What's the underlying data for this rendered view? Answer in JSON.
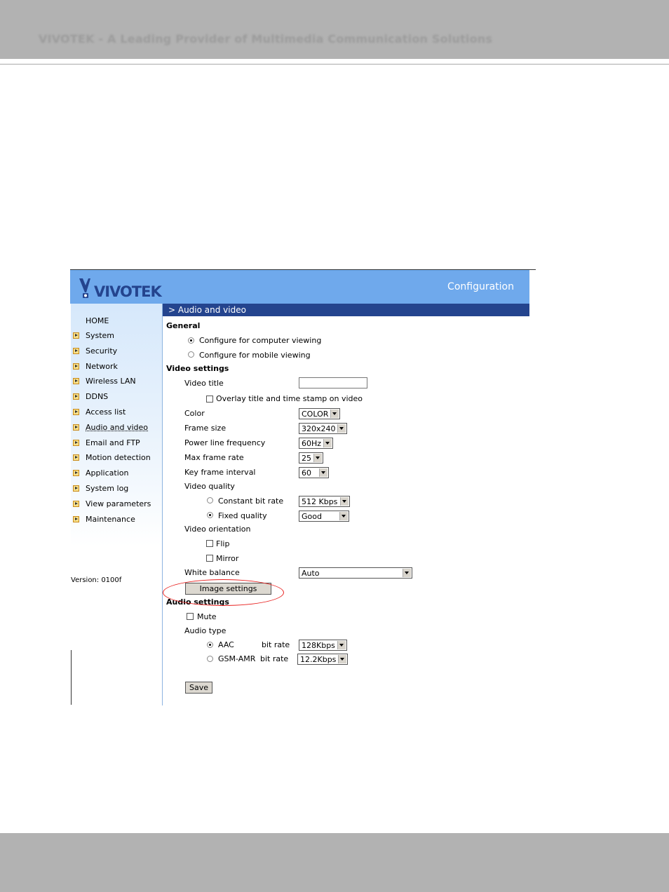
{
  "page_header": {
    "text": "VIVOTEK - A Leading Provider of Multimedia Communication Solutions"
  },
  "banner": {
    "logo_text": "VIVOTEK",
    "title": "Configuration"
  },
  "sidebar": {
    "home": "HOME",
    "items": [
      {
        "label": "System"
      },
      {
        "label": "Security"
      },
      {
        "label": "Network"
      },
      {
        "label": "Wireless LAN"
      },
      {
        "label": "DDNS"
      },
      {
        "label": "Access list"
      },
      {
        "label": "Audio and video"
      },
      {
        "label": "Email and FTP"
      },
      {
        "label": "Motion detection"
      },
      {
        "label": "Application"
      },
      {
        "label": "System log"
      },
      {
        "label": "View parameters"
      },
      {
        "label": "Maintenance"
      }
    ],
    "version": "Version: 0100f"
  },
  "section": {
    "title": "> Audio and video"
  },
  "general": {
    "heading": "General",
    "computer_viewing": "Configure for computer viewing",
    "mobile_viewing": "Configure for mobile viewing"
  },
  "video": {
    "heading": "Video settings",
    "title_label": "Video title",
    "title_value": "",
    "overlay_label": "Overlay title and time stamp on video",
    "color_label": "Color",
    "color_value": "COLOR",
    "frame_size_label": "Frame size",
    "frame_size_value": "320x240",
    "power_line_label": "Power line frequency",
    "power_line_value": "60Hz",
    "max_frame_rate_label": "Max frame rate",
    "max_frame_rate_value": "25",
    "key_frame_label": "Key frame interval",
    "key_frame_value": "60",
    "quality_label": "Video quality",
    "constant_bit_rate_label": "Constant bit rate",
    "constant_bit_rate_value": "512 Kbps",
    "fixed_quality_label": "Fixed quality",
    "fixed_quality_value": "Good",
    "orientation_label": "Video orientation",
    "flip_label": "Flip",
    "mirror_label": "Mirror",
    "white_balance_label": "White balance",
    "white_balance_value": "Auto",
    "image_settings_button": "Image settings"
  },
  "audio": {
    "heading": "Audio settings",
    "mute_label": "Mute",
    "type_label": "Audio type",
    "aac_label": "AAC",
    "aac_bitrate_label": "bit rate",
    "aac_bitrate_value": "128Kbps",
    "gsm_label": "GSM-AMR",
    "gsm_bitrate_label": "bit rate",
    "gsm_bitrate_value": "12.2Kbps"
  },
  "save_button": "Save",
  "colors": {
    "banner": "#6fa9ec",
    "section_bar": "#24448e",
    "highlight": "#e8201e",
    "page_band": "#b2b2b2"
  }
}
